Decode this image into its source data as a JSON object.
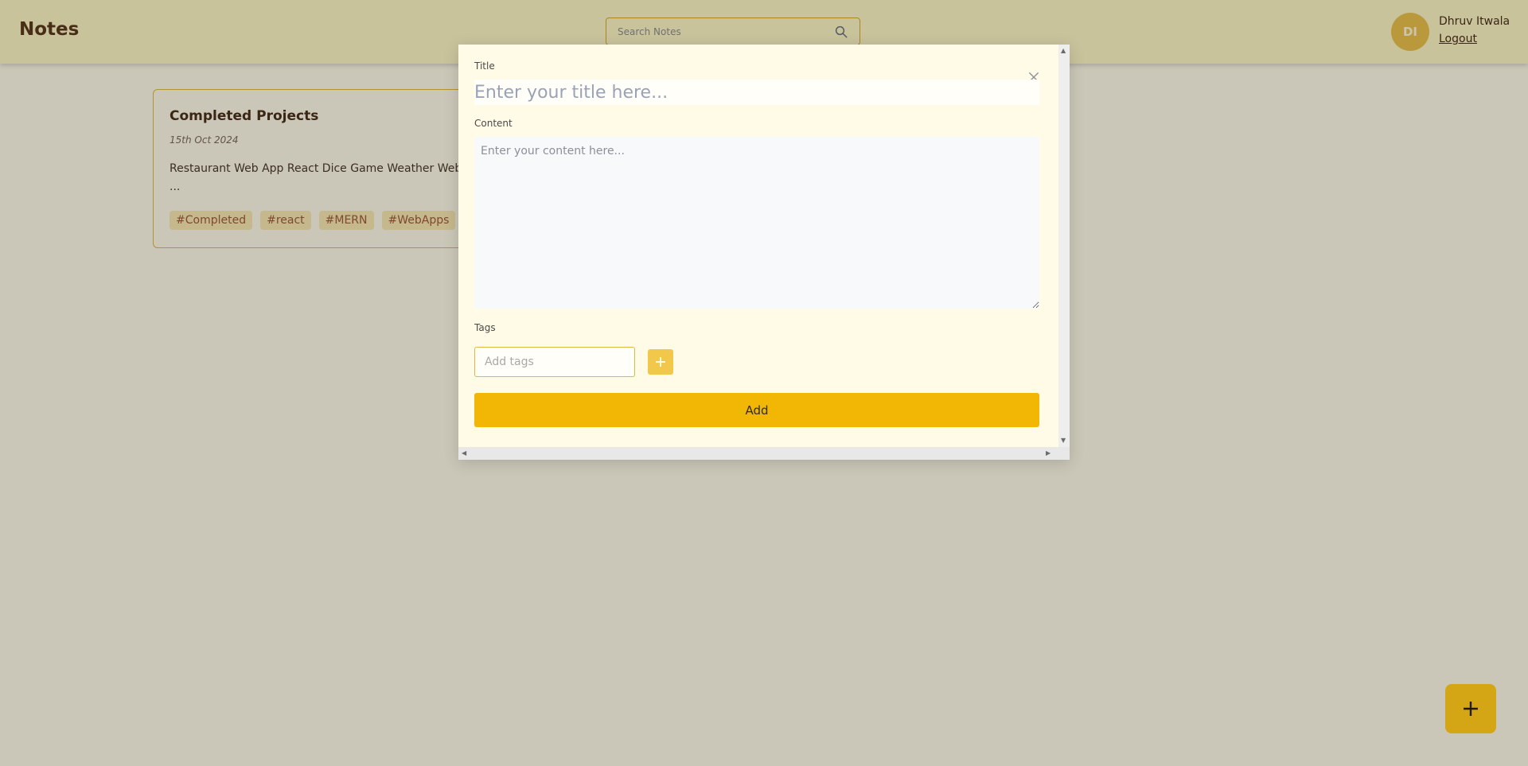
{
  "header": {
    "app_title": "Notes",
    "search": {
      "placeholder": "Search Notes",
      "value": ""
    },
    "user": {
      "initials": "DI",
      "name": "Dhruv Itwala",
      "logout_label": "Logout"
    }
  },
  "notes": [
    {
      "title": "Completed Projects",
      "date": "15th Oct 2024",
      "content": "Restaurant Web App React Dice Game Weather Web to ...",
      "tags": [
        "#Completed",
        "#react",
        "#MERN",
        "#WebApps"
      ]
    }
  ],
  "modal": {
    "title_label": "Title",
    "title_placeholder": "Enter your title here...",
    "content_label": "Content",
    "content_placeholder": "Enter your content here...",
    "tags_label": "Tags",
    "tags_placeholder": "Add tags",
    "add_label": "Add"
  },
  "colors": {
    "accent": "#f2b705",
    "header_bg": "#fcf4c4",
    "page_bg": "#fdf9e6",
    "fab": "#d4a514"
  },
  "icons": {
    "search": "search-icon",
    "close": "close-icon",
    "add_tag": "plus-icon",
    "fab": "plus-icon"
  }
}
